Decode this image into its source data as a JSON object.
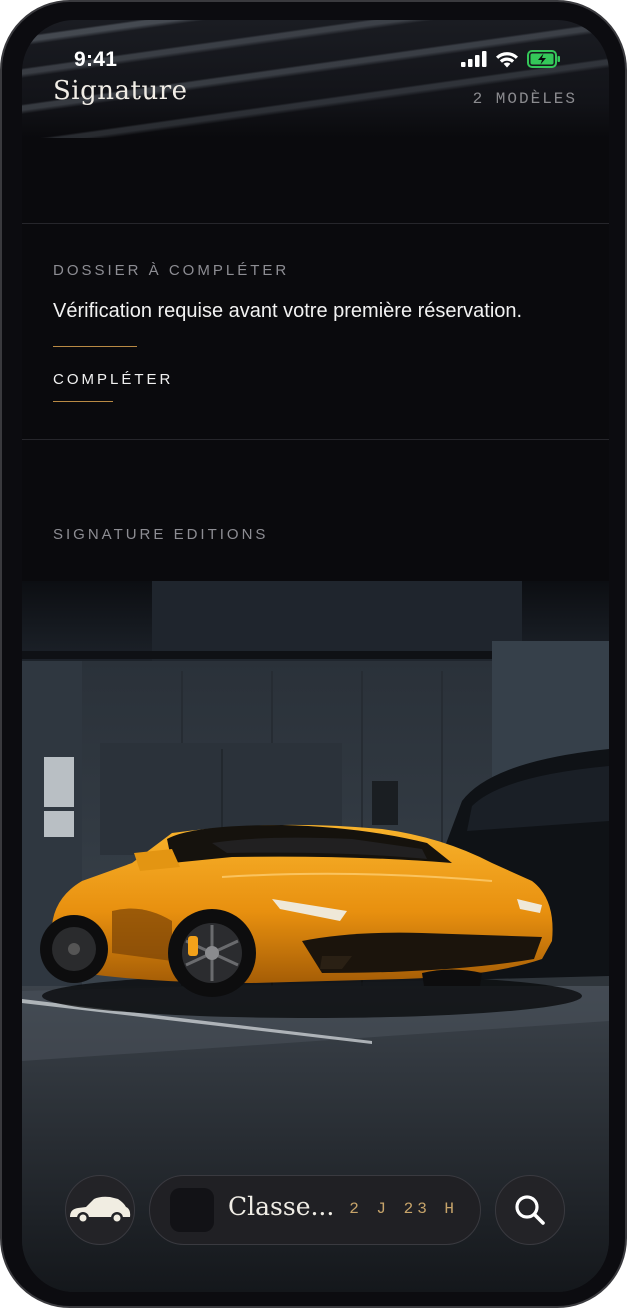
{
  "status_bar": {
    "time": "9:41"
  },
  "header": {
    "title": "Signature",
    "count": "2 MODÈLES"
  },
  "notice": {
    "label": "DOSSIER À COMPLÉTER",
    "message": "Vérification requise avant votre première réservation.",
    "cta": "COMPLÉTER"
  },
  "editions": {
    "label": "SIGNATURE EDITIONS"
  },
  "bottom_nav": {
    "left_icon": "car-icon",
    "current_title": "Classe...",
    "remaining": "2 J 23 H",
    "right_icon": "search-icon"
  },
  "colors": {
    "accent_gold": "#b98a44",
    "car_orange": "#f2a11a",
    "background": "#0a0a0d"
  }
}
